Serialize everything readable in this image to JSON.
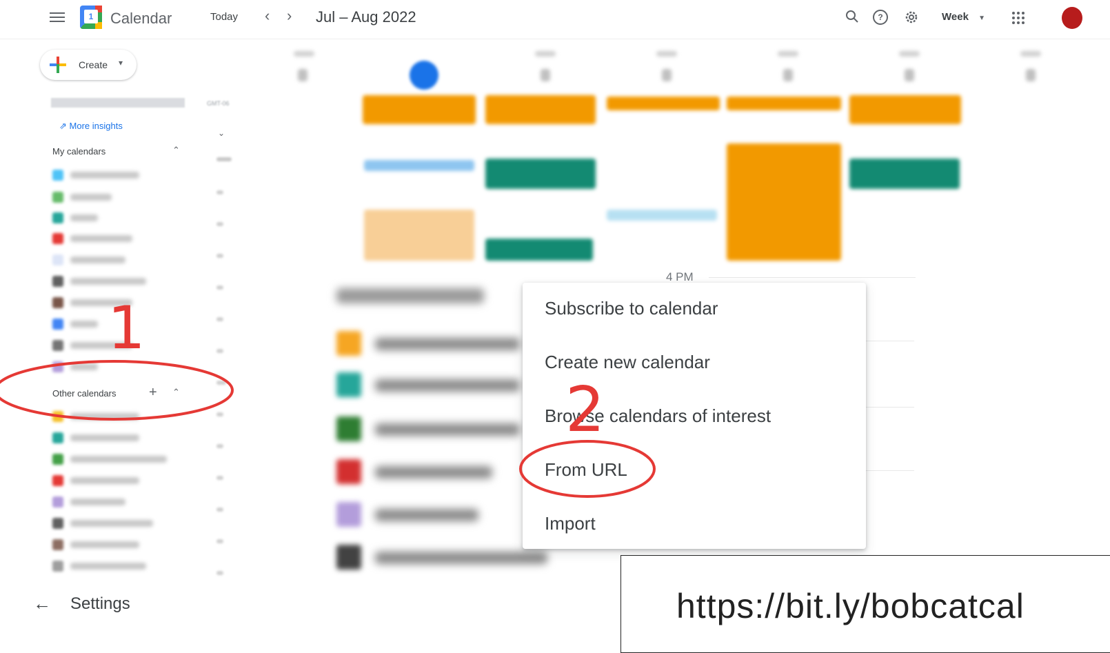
{
  "header": {
    "app_title": "Calendar",
    "logo_day": "1",
    "today_label": "Today",
    "prev_icon": "chevron-left-icon",
    "next_icon": "chevron-right-icon",
    "date_range": "Jul – Aug 2022",
    "search_icon": "search-icon",
    "help_icon": "help-icon",
    "settings_icon": "gear-icon",
    "view_label": "Week",
    "apps_icon": "apps-grid-icon"
  },
  "sidebar": {
    "create_label": "Create",
    "more_insights": "More insights",
    "my_calendars": "My calendars",
    "other_calendars": "Other calendars"
  },
  "gutter": {
    "timezone": "GMT-06"
  },
  "grid": {
    "time_label": "4 PM"
  },
  "menu": {
    "items": [
      "Subscribe to calendar",
      "Create new calendar",
      "Browse calendars of interest",
      "From URL",
      "Import"
    ]
  },
  "annotations": {
    "step1": "1",
    "step2": "2",
    "url": "https://bit.ly/bobcatcal"
  },
  "footer": {
    "settings_label": "Settings"
  },
  "colors": {
    "accent_blue": "#1a73e8",
    "event_orange": "#f29900",
    "event_teal": "#0b8043",
    "annotation_red": "#e53935"
  }
}
